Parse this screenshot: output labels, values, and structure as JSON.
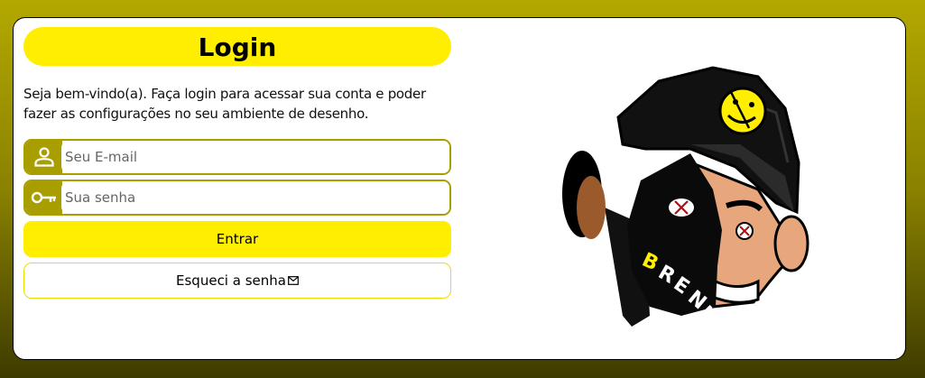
{
  "login": {
    "title": "Login",
    "description": "Seja bem-vindo(a). Faça login para acessar sua conta e poder fazer as configurações no seu ambiente de desenho.",
    "email_placeholder": "Seu E-mail",
    "password_placeholder": "Sua senha",
    "submit_label": "Entrar",
    "forgot_label": "Esqueci a senha",
    "icons": {
      "email": "user-icon",
      "password": "key-icon",
      "forgot": "envelope-icon"
    }
  },
  "illustration": {
    "name": "cartoon-character-illustration",
    "text": "BRENIN"
  },
  "colors": {
    "accent": "#ffee00",
    "field_border": "#a89e00",
    "background_top": "#b3a800",
    "background_bottom": "#3e3b00"
  }
}
